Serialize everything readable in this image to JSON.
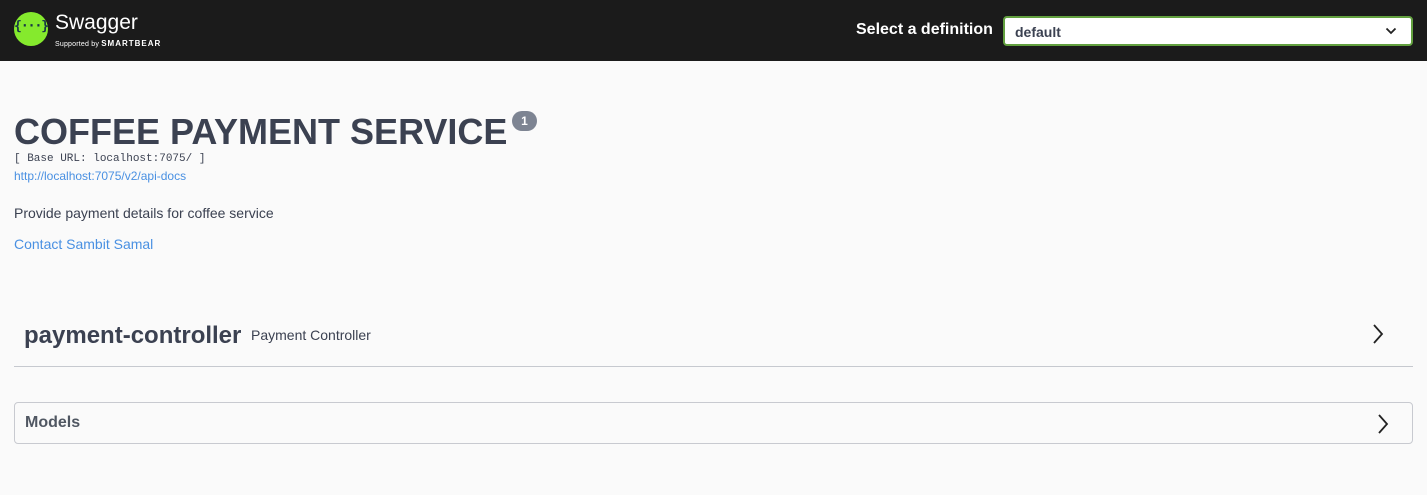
{
  "topbar": {
    "logo_glyph": "{···}",
    "logo_title": "Swagger",
    "logo_sub_prefix": "Supported by",
    "logo_sub_brand": "SMARTBEAR",
    "select_label": "Select a definition",
    "select_value": "default",
    "accent_color": "#85ea2d",
    "border_color": "#62a03f"
  },
  "info": {
    "title": "COFFEE PAYMENT SERVICE",
    "version_badge": "1",
    "base_url": "[ Base URL: localhost:7075/ ]",
    "api_docs_link": "http://localhost:7075/v2/api-docs",
    "description": "Provide payment details for coffee service",
    "contact": "Contact Sambit Samal",
    "link_color": "#4990e2"
  },
  "tags": [
    {
      "name": "payment-controller",
      "description": "Payment Controller",
      "icon": "chevron-right-icon"
    }
  ],
  "models": {
    "title": "Models",
    "icon": "chevron-right-icon"
  }
}
